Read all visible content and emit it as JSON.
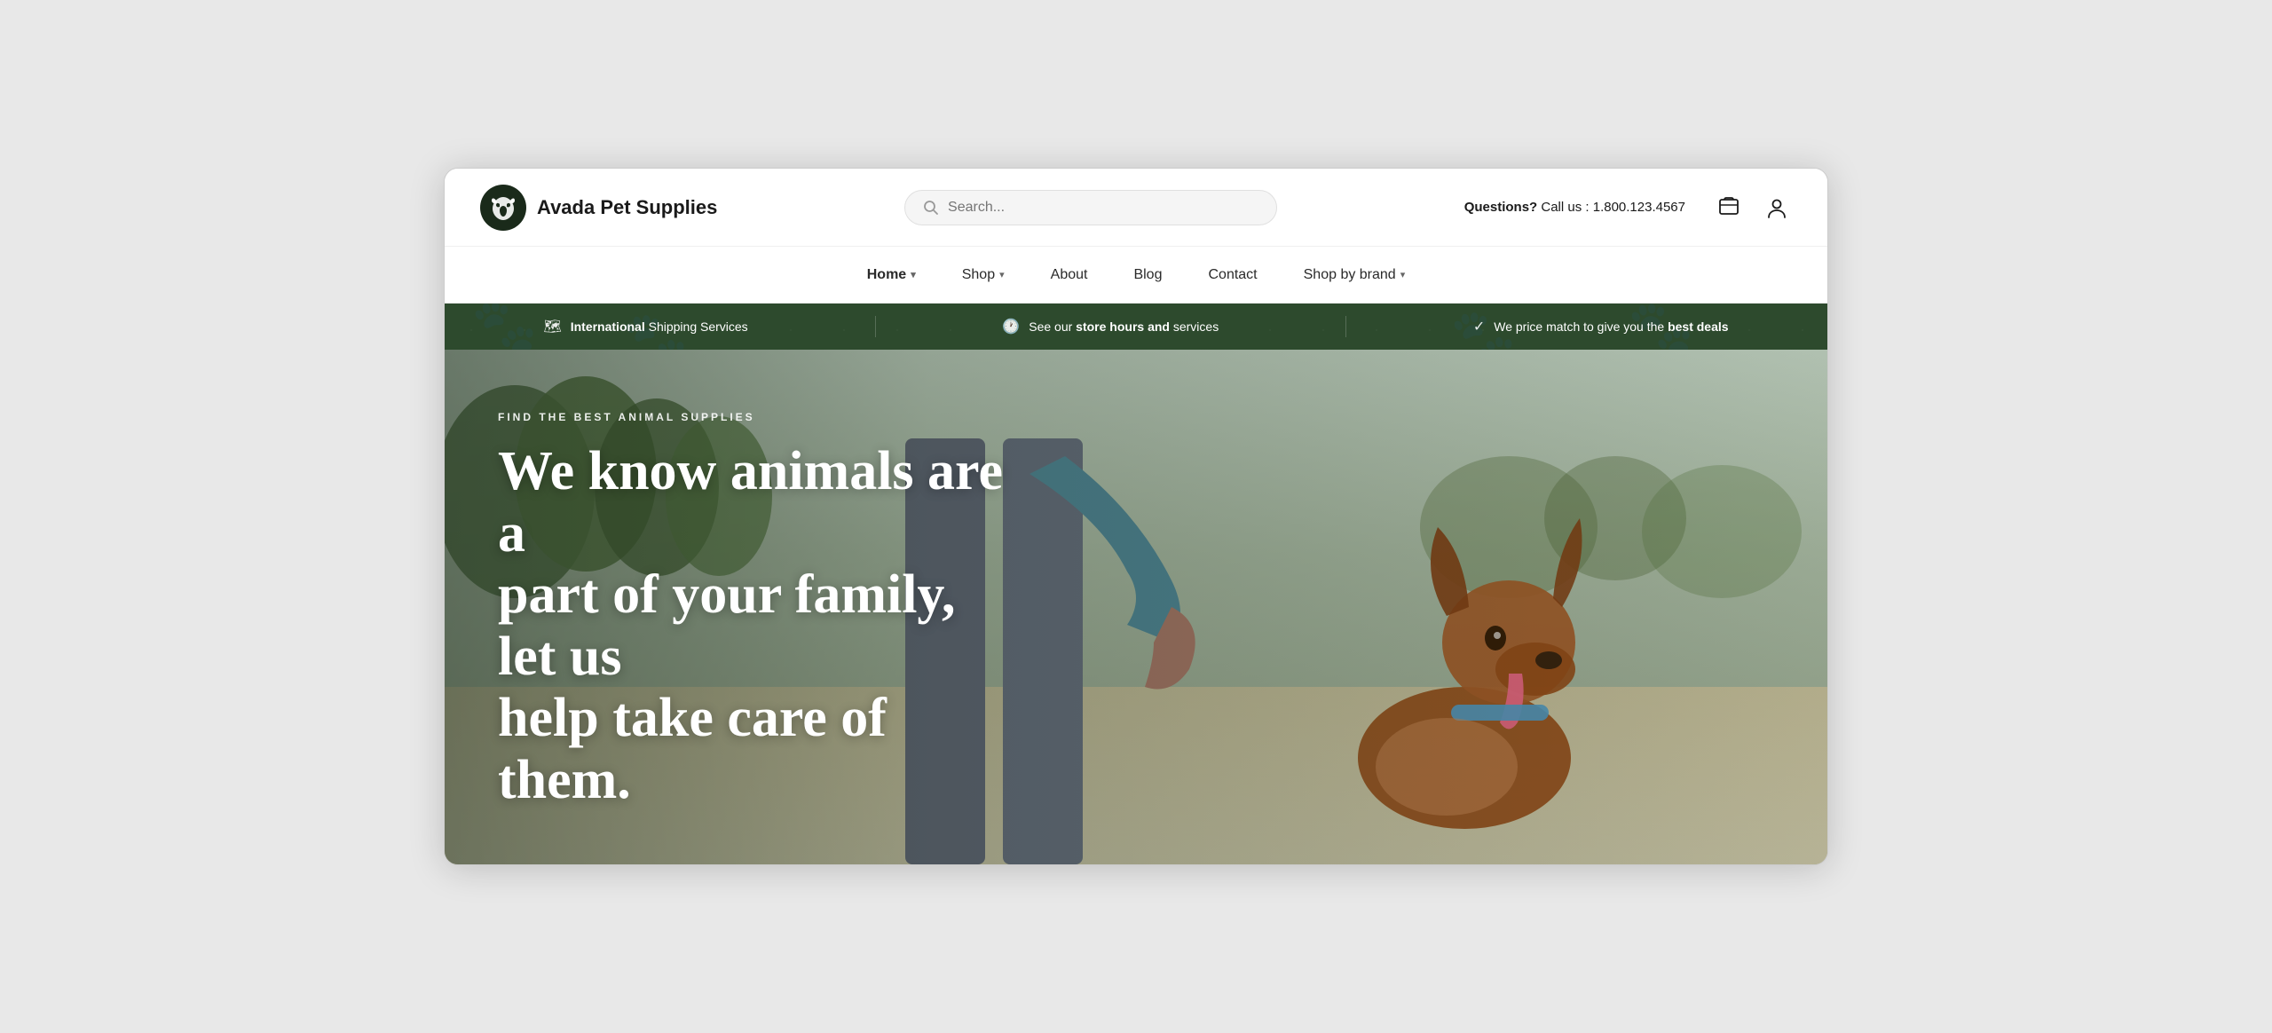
{
  "brand": {
    "logo_alt": "Avada Pet Supplies logo",
    "name": "Avada Pet Supplies"
  },
  "search": {
    "placeholder": "Search..."
  },
  "header": {
    "contact_label": "Questions?",
    "contact_text": "Call us : 1.800.123.4567"
  },
  "nav": {
    "items": [
      {
        "id": "home",
        "label": "Home",
        "has_dropdown": true,
        "active": true
      },
      {
        "id": "shop",
        "label": "Shop",
        "has_dropdown": true,
        "active": false
      },
      {
        "id": "about",
        "label": "About",
        "has_dropdown": false,
        "active": false
      },
      {
        "id": "blog",
        "label": "Blog",
        "has_dropdown": false,
        "active": false
      },
      {
        "id": "contact",
        "label": "Contact",
        "has_dropdown": false,
        "active": false
      },
      {
        "id": "shop-by-brand",
        "label": "Shop by brand",
        "has_dropdown": true,
        "active": false
      }
    ]
  },
  "promo_bar": {
    "items": [
      {
        "id": "shipping",
        "icon": "🗺",
        "text_parts": [
          {
            "bold": true,
            "text": "International"
          },
          {
            "bold": false,
            "text": " Shipping Services"
          }
        ]
      },
      {
        "id": "hours",
        "icon": "🕐",
        "text_parts": [
          {
            "bold": false,
            "text": "See our "
          },
          {
            "bold": true,
            "text": "store hours and"
          },
          {
            "bold": false,
            "text": " services"
          }
        ]
      },
      {
        "id": "price",
        "icon": "✓",
        "text_parts": [
          {
            "bold": false,
            "text": "We price match to give you the "
          },
          {
            "bold": true,
            "text": "best deals"
          }
        ]
      }
    ]
  },
  "hero": {
    "eyebrow": "FIND THE BEST ANIMAL SUPPLIES",
    "heading_line1": "We know animals are a",
    "heading_line2": "part of your family, let us",
    "heading_line3": "help take care of them."
  }
}
